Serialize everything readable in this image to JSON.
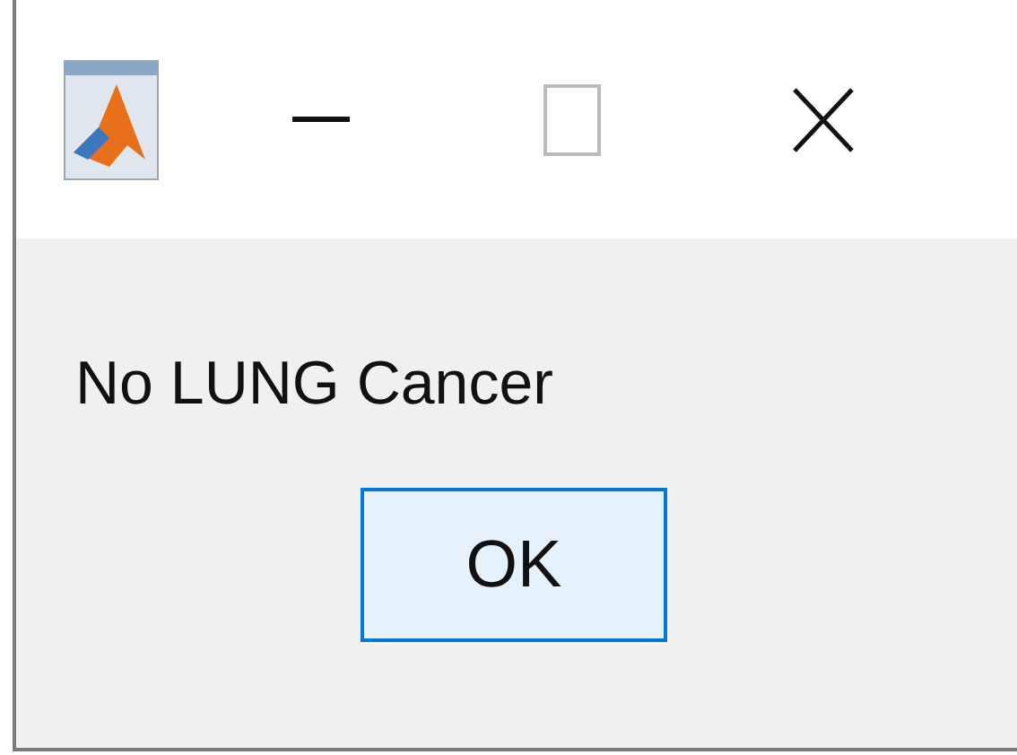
{
  "message": "No LUNG Cancer",
  "buttons": [
    {
      "label": "OK",
      "selected": true
    }
  ]
}
